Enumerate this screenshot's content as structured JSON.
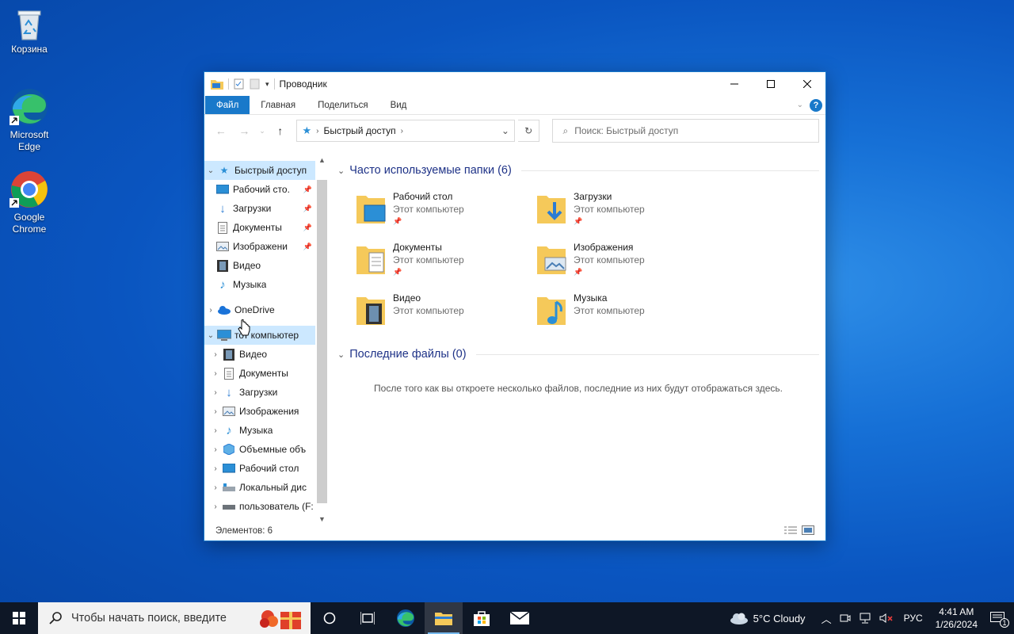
{
  "desktop": {
    "icons": [
      {
        "label": "Корзина"
      },
      {
        "label": "Microsoft Edge"
      },
      {
        "label": "Google Chrome"
      }
    ]
  },
  "window": {
    "title": "Проводник",
    "ribbon_tabs": [
      "Файл",
      "Главная",
      "Поделиться",
      "Вид"
    ],
    "address": {
      "crumb": "Быстрый доступ"
    },
    "search": {
      "placeholder": "Поиск: Быстрый доступ"
    },
    "nav": {
      "quick_access": "Быстрый доступ",
      "quick_items": [
        "Рабочий сто.",
        "Загрузки",
        "Документы",
        "Изображени",
        "Видео",
        "Музыка"
      ],
      "onedrive": "OneDrive",
      "this_pc": "тот компьютер",
      "pc_items": [
        "Видео",
        "Документы",
        "Загрузки",
        "Изображения",
        "Музыка",
        "Объемные объ",
        "Рабочий стол",
        "Локальный дис",
        "пользователь (F:"
      ]
    },
    "content": {
      "frequent_header": "Часто используемые папки (6)",
      "folders": [
        {
          "name": "Рабочий стол",
          "location": "Этот компьютер",
          "pinned": true
        },
        {
          "name": "Загрузки",
          "location": "Этот компьютер",
          "pinned": true
        },
        {
          "name": "Документы",
          "location": "Этот компьютер",
          "pinned": true
        },
        {
          "name": "Изображения",
          "location": "Этот компьютер",
          "pinned": true
        },
        {
          "name": "Видео",
          "location": "Этот компьютер",
          "pinned": false
        },
        {
          "name": "Музыка",
          "location": "Этот компьютер",
          "pinned": false
        }
      ],
      "recent_header": "Последние файлы (0)",
      "recent_empty": "После того как вы откроете несколько файлов, последние из них будут отображаться здесь."
    },
    "status": "Элементов: 6"
  },
  "taskbar": {
    "search_placeholder": "Чтобы начать поиск, введите",
    "weather": "5°C  Cloudy",
    "lang": "РУС",
    "time": "4:41 AM",
    "date": "1/26/2024",
    "notifications": "1"
  },
  "colors": {
    "accent": "#1979ca",
    "selected": "#cce8ff",
    "group_header": "#1e3287",
    "folder": "#f5c95a"
  }
}
